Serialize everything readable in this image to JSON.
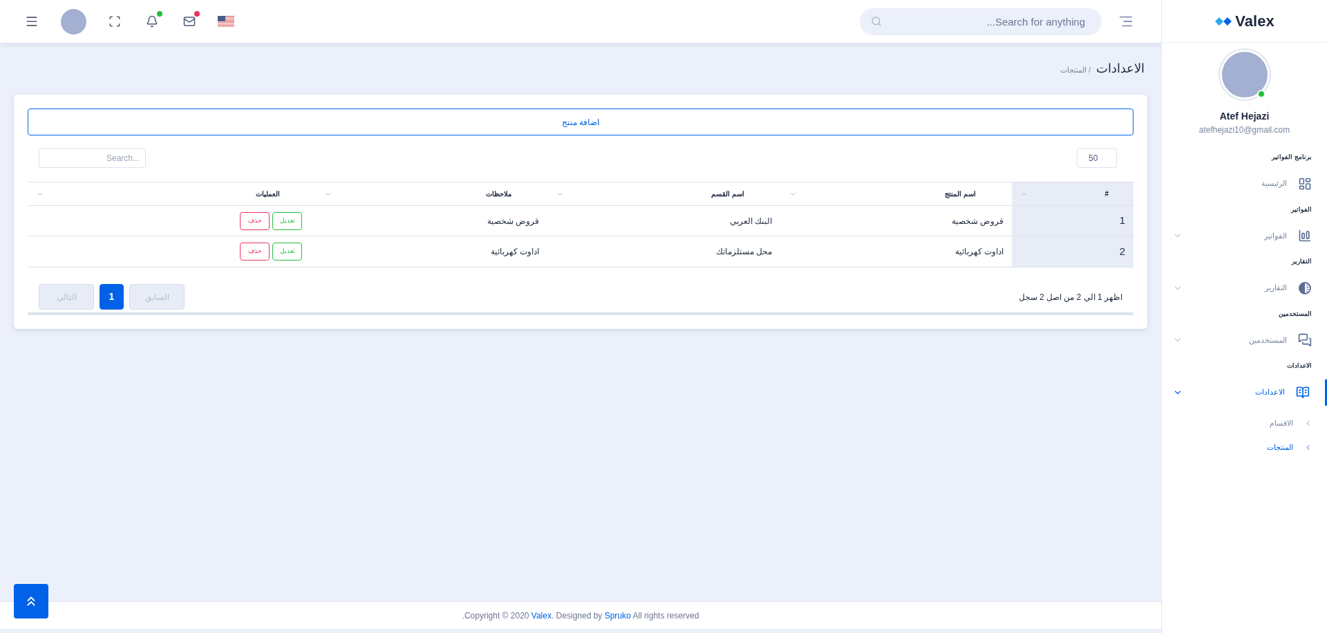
{
  "header": {
    "icons": [
      {
        "kind": "menu"
      },
      {
        "kind": "avatar"
      },
      {
        "kind": "fullscreen"
      },
      {
        "kind": "bell",
        "color": "#22c03c"
      },
      {
        "kind": "mail",
        "color": "#ee335e"
      },
      {
        "kind": "flag"
      }
    ],
    "search": {
      "placeholder": "...Search for anything"
    }
  },
  "brand": {
    "name": "Valex"
  },
  "user": {
    "name": "Atef Hejazi",
    "email": "atefhejazi10@gmail.com",
    "online": true
  },
  "sidebar": {
    "sections": [
      {
        "category": "برنامج الفواتير",
        "item": {
          "label": "الرئيسية",
          "expandable": false,
          "selected": false
        }
      },
      {
        "category": "الفواتير",
        "item": {
          "label": "الفواتير",
          "expandable": true,
          "selected": false
        }
      },
      {
        "category": "التقارير",
        "item": {
          "label": "التقارير",
          "expandable": true,
          "selected": false
        }
      },
      {
        "category": "المستخدمين",
        "item": {
          "label": "المستخدمين",
          "expandable": true,
          "selected": false
        }
      },
      {
        "category": "الاعدادات",
        "item": {
          "label": "الاعدادات",
          "expandable": true,
          "selected": true,
          "expanded": true,
          "children": [
            {
              "label": "الاقسام",
              "selected": false
            },
            {
              "label": "المنتجات",
              "selected": true
            }
          ]
        }
      }
    ]
  },
  "breadcrumb": {
    "title": "الاعدادات",
    "sub": "/ المنتجات"
  },
  "add_button": "اضافة منتج",
  "page_length": "50",
  "table_search": {
    "placeholder": "Search..."
  },
  "table": {
    "columns": [
      {
        "label": "#",
        "sorted": true
      },
      {
        "label": "اسم المنتج",
        "sorted": false
      },
      {
        "label": "اسم القسم",
        "sorted": false
      },
      {
        "label": "ملاحظات",
        "sorted": false
      },
      {
        "label": "العمليات",
        "sorted": false
      }
    ],
    "rows": [
      {
        "cells": [
          "1",
          "قروض شخصية",
          "البنك العربي",
          "قروض شخصية"
        ],
        "actions": [
          "تعديل",
          "حذف"
        ]
      },
      {
        "cells": [
          "2",
          "اداوت كهربائية",
          "محل مستلزماتك",
          "اداوت كهربائية"
        ],
        "actions": [
          "تعديل",
          "حذف"
        ]
      }
    ]
  },
  "table_info": "اظهر 1 الي 2 من اصل 2 سجل",
  "pagination": [
    {
      "label": "السابق",
      "selected": false,
      "disabled": true
    },
    {
      "label": "1",
      "selected": true,
      "disabled": false
    },
    {
      "label": "التالي",
      "selected": false,
      "disabled": true
    }
  ],
  "footer": {
    "prefix": ".Copyright © 2020 ",
    "brand_link": "Valex",
    "middle": ". Designed by ",
    "author_link": "Spruko",
    "suffix": " All rights reserved"
  }
}
